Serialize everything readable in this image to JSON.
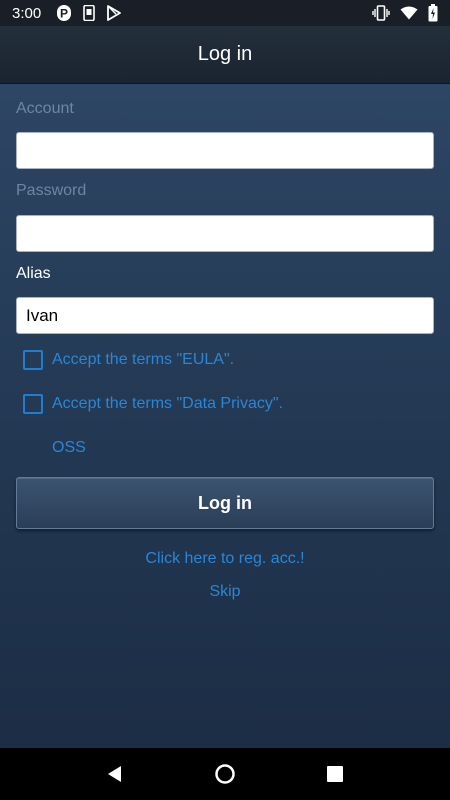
{
  "status_bar": {
    "time": "3:00",
    "notification_icons": [
      "parking-icon",
      "phone-icon",
      "play-store-icon"
    ],
    "system_icons": [
      "vibrate-icon",
      "wifi-icon",
      "battery-icon"
    ]
  },
  "header": {
    "title": "Log in"
  },
  "form": {
    "account_label": "Account",
    "account_value": "",
    "password_label": "Password",
    "password_value": "",
    "alias_label": "Alias",
    "alias_value": "Ivan",
    "eula_label": "Accept the terms \"EULA\".",
    "privacy_label": "Accept the terms \"Data Privacy\".",
    "oss_label": "OSS",
    "login_button": "Log in",
    "register_link": "Click here to reg. acc.!",
    "skip_link": "Skip"
  },
  "colors": {
    "accent": "#2a86d6",
    "background": "#243a55",
    "header": "#1f2934"
  }
}
